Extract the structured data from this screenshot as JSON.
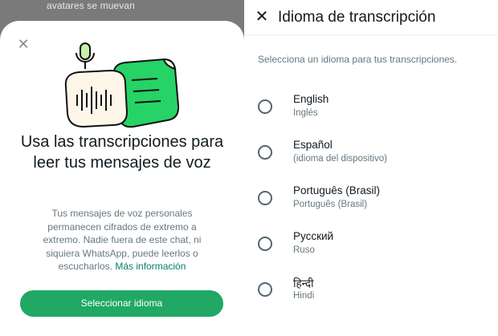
{
  "background_text": "avatares se muevan",
  "sheet": {
    "close_icon": "close-icon",
    "title": "Usa las transcripciones para leer tus mensajes de voz",
    "body": "Tus mensajes de voz personales permanecen cifrados de extremo a extremo. Nadie fuera de este chat, ni siquiera WhatsApp, puede leerlos o escucharlos.",
    "more_info_link": "Más información",
    "button_label": "Seleccionar idioma",
    "accent_color": "#21a865"
  },
  "language_screen": {
    "title": "Idioma de transcripción",
    "subtitle": "Selecciona un idioma para tus transcripciones.",
    "languages": [
      {
        "name": "English",
        "native": "Inglés"
      },
      {
        "name": "Español",
        "native": "(idioma del dispositivo)"
      },
      {
        "name": "Português (Brasil)",
        "native": "Português (Brasil)"
      },
      {
        "name": "Русский",
        "native": "Ruso"
      },
      {
        "name": "हिन्दी",
        "native": "Hindi"
      }
    ]
  }
}
